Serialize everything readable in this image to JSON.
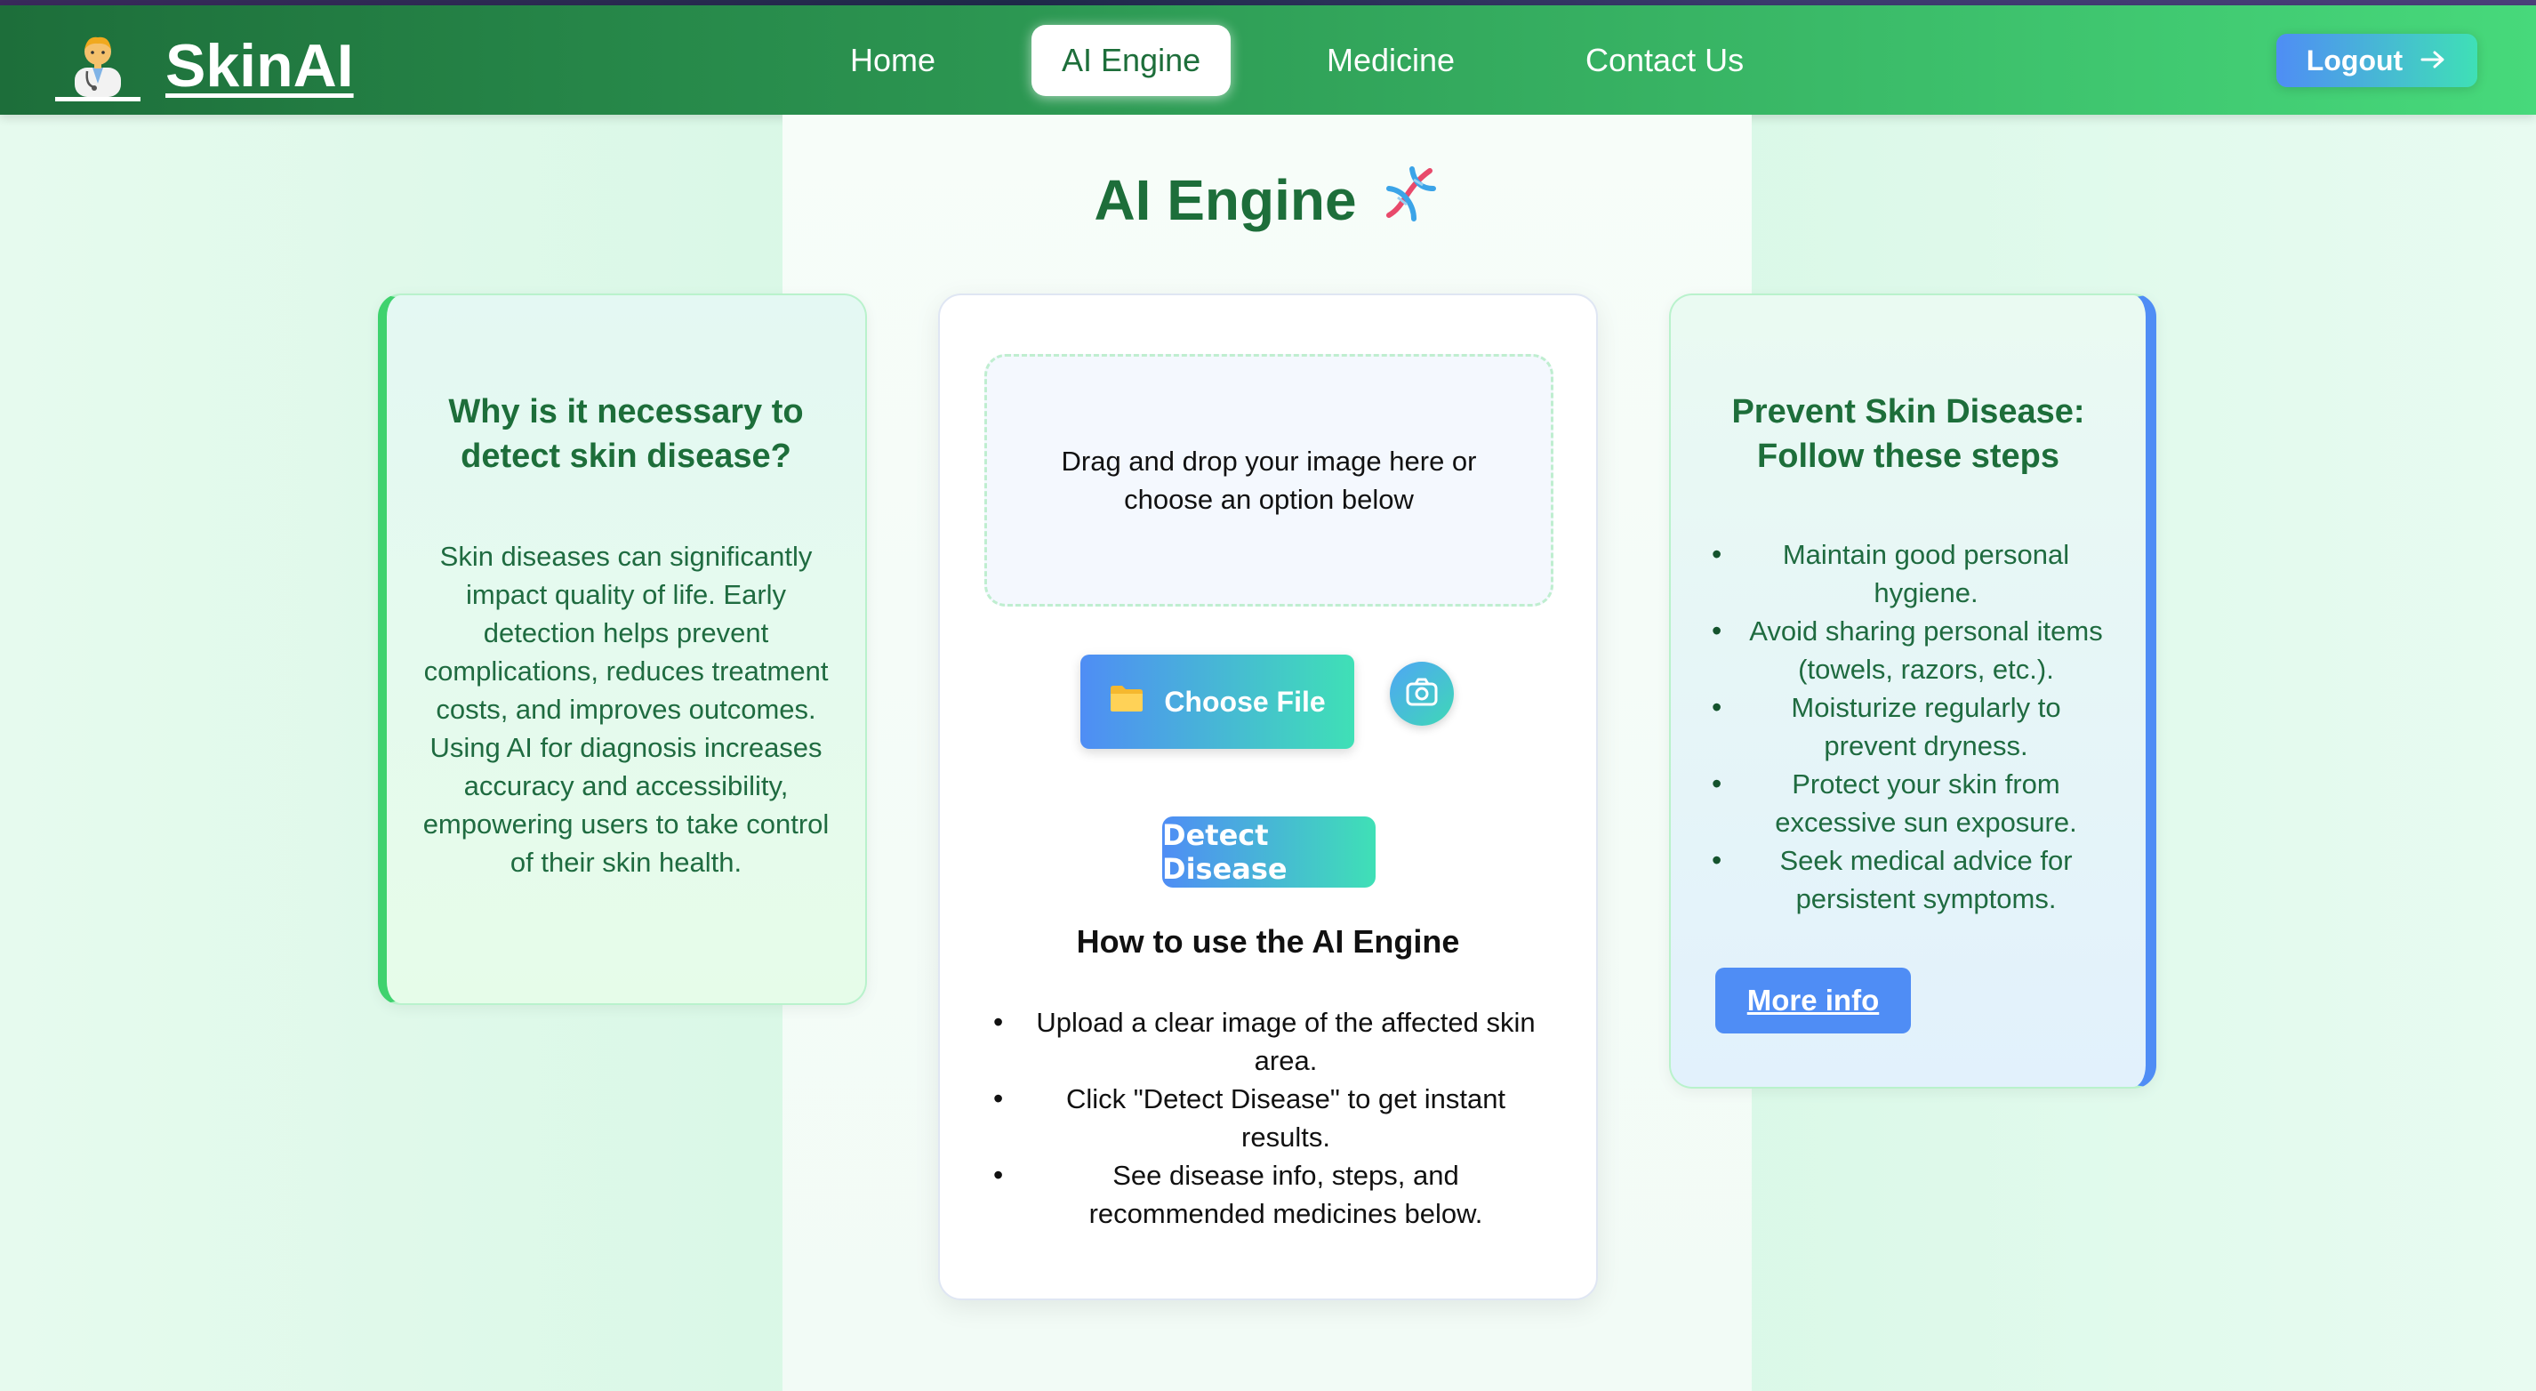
{
  "brand": {
    "name": "SkinAI",
    "logo_icon": "doctor-icon"
  },
  "nav": {
    "items": [
      {
        "label": "Home",
        "active": false
      },
      {
        "label": "AI Engine",
        "active": true
      },
      {
        "label": "Medicine",
        "active": false
      },
      {
        "label": "Contact Us",
        "active": false
      }
    ],
    "logout_label": "Logout",
    "logout_icon": "arrow-right-icon"
  },
  "page": {
    "title": "AI Engine",
    "title_icon": "dna-icon"
  },
  "left_card": {
    "title": "Why is it necessary to detect skin disease?",
    "body": "Skin diseases can significantly impact quality of life. Early detection helps prevent complications, reduces treatment costs, and improves outcomes. Using AI for diagnosis increases accuracy and accessibility, empowering users to take control of their skin health."
  },
  "upload": {
    "dropzone_text": "Drag and drop your image here or choose an option below",
    "choose_file_label": "Choose File",
    "choose_file_icon": "folder-icon",
    "camera_icon": "camera-icon",
    "detect_label": "Detect Disease"
  },
  "howto": {
    "title": "How to use the AI Engine",
    "steps": [
      "Upload a clear image of the affected skin area.",
      "Click \"Detect Disease\" to get instant results.",
      "See disease info, steps, and recommended medicines below."
    ]
  },
  "right_card": {
    "title": "Prevent Skin Disease: Follow these steps",
    "steps": [
      "Maintain good personal hygiene.",
      "Avoid sharing personal items (towels, razors, etc.).",
      "Moisturize regularly to prevent dryness.",
      "Protect your skin from excessive sun exposure.",
      "Seek medical advice for persistent symptoms."
    ],
    "more_info_label": "More info"
  },
  "colors": {
    "nav_start": "#1d6e3a",
    "nav_end": "#47d97b",
    "accent_blue": "#4f8df5",
    "accent_teal": "#3fe0b6",
    "heading_green": "#1d6e3a"
  }
}
